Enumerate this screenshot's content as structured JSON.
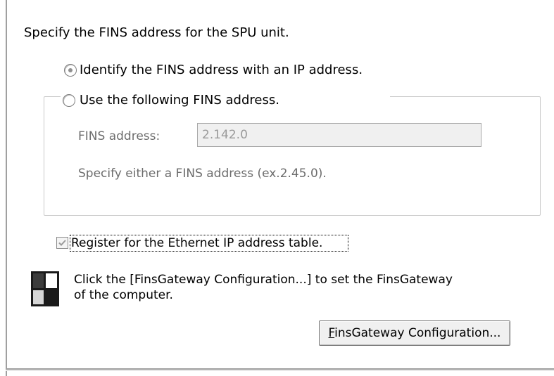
{
  "intro_text": "Specify the FINS address for the SPU unit.",
  "radio_ip": {
    "label": "Identify the FINS address with an IP address.",
    "checked": true
  },
  "radio_fixed": {
    "label": "Use the following FINS address.",
    "checked": false
  },
  "fins_address": {
    "label": "FINS address:",
    "value": "2.142.0"
  },
  "hint_text": "Specify either a FINS address (ex.2.45.0).",
  "register_checkbox": {
    "label": "Register for the Ethernet IP address table.",
    "checked": true
  },
  "info": {
    "line1": "Click the [FinsGateway Configuration...] to set the FinsGateway",
    "line2": "of the computer.",
    "icon": "finsgateway-logo-icon"
  },
  "config_button": {
    "mnemonic": "F",
    "label_rest": "insGateway Configuration..."
  }
}
